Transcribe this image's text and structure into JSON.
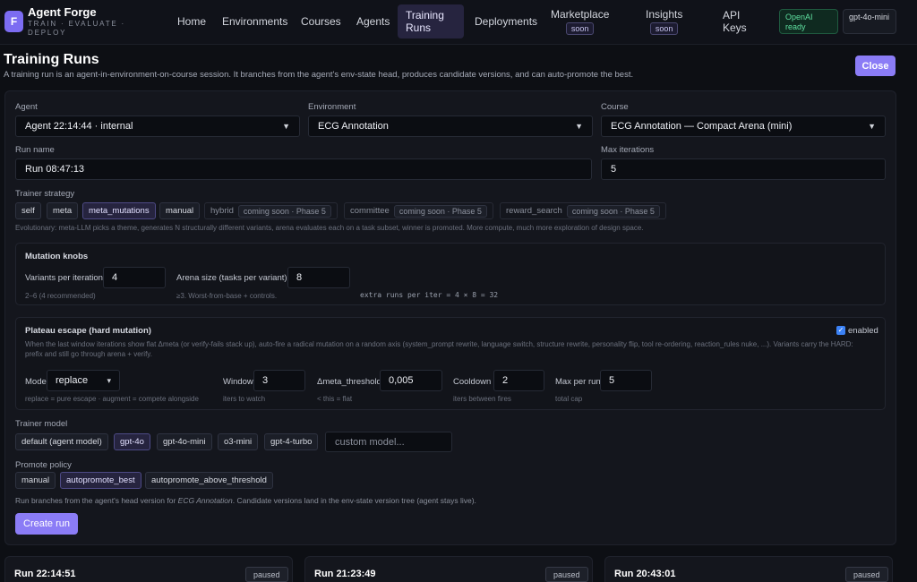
{
  "brand": {
    "logo_letter": "F",
    "title": "Agent Forge",
    "subtitle": "TRAIN · EVALUATE · DEPLOY"
  },
  "nav": [
    {
      "label": "Home"
    },
    {
      "label": "Environments"
    },
    {
      "label": "Courses"
    },
    {
      "label": "Agents"
    },
    {
      "label": "Training Runs",
      "active": true
    },
    {
      "label": "Deployments"
    },
    {
      "label": "Marketplace",
      "badge": "soon"
    },
    {
      "label": "Insights",
      "badge": "soon"
    },
    {
      "label": "API Keys"
    }
  ],
  "status": {
    "provider": "OpenAI ready",
    "model": "gpt-4o-mini"
  },
  "page": {
    "title": "Training Runs",
    "description": "A training run is an agent-in-environment-on-course session. It branches from the agent's env-state head, produces candidate versions, and can auto-promote the best.",
    "close_label": "Close"
  },
  "form": {
    "agent_label": "Agent",
    "agent_value": "Agent 22:14:44 · internal",
    "environment_label": "Environment",
    "environment_value": "ECG Annotation",
    "course_label": "Course",
    "course_value": "ECG Annotation — Compact Arena (mini)",
    "run_name_label": "Run name",
    "run_name_value": "Run 08:47:13",
    "max_iter_label": "Max iterations",
    "max_iter_value": "5",
    "strategy_label": "Trainer strategy",
    "strategies": [
      {
        "label": "self"
      },
      {
        "label": "meta"
      },
      {
        "label": "meta_mutations",
        "selected": true
      },
      {
        "label": "manual"
      },
      {
        "label": "hybrid",
        "tag": "coming soon · Phase 5"
      },
      {
        "label": "committee",
        "tag": "coming soon · Phase 5"
      },
      {
        "label": "reward_search",
        "tag": "coming soon · Phase 5"
      }
    ],
    "strategy_hint": "Evolutionary: meta-LLM picks a theme, generates N structurally different variants, arena evaluates each on a task subset, winner is promoted. More compute, much more exploration of design space.",
    "knobs": {
      "title": "Mutation knobs",
      "variants_label": "Variants per iteration",
      "variants_value": "4",
      "variants_hint": "2–6 (4 recommended)",
      "arena_label": "Arena size (tasks per variant)",
      "arena_value": "8",
      "arena_hint": "≥3. Worst-from-base + controls.",
      "extra_runs": "extra runs per iter = 4 × 8 = 32"
    },
    "plateau": {
      "title": "Plateau escape (hard mutation)",
      "enabled_label": "enabled",
      "desc": "When the last window iterations show flat Δmeta (or verify-fails stack up), auto-fire a radical mutation on a random axis (system_prompt rewrite, language switch, structure rewrite, personality flip, tool re-ordering, reaction_rules nuke, ...). Variants carry the HARD: prefix and still go through arena + verify.",
      "mode_label": "Mode",
      "mode_value": "replace",
      "mode_hint": "replace = pure escape · augment = compete alongside",
      "window_label": "Window",
      "window_value": "3",
      "window_hint": "iters to watch",
      "threshold_label": "Δmeta_threshold",
      "threshold_value": "0,005",
      "threshold_hint": "< this = flat",
      "cooldown_label": "Cooldown",
      "cooldown_value": "2",
      "cooldown_hint": "iters between fires",
      "maxrun_label": "Max per run",
      "maxrun_value": "5",
      "maxrun_hint": "total cap"
    },
    "trainer_model_label": "Trainer model",
    "trainer_models": [
      {
        "label": "default (agent model)"
      },
      {
        "label": "gpt-4o",
        "selected": true
      },
      {
        "label": "gpt-4o-mini"
      },
      {
        "label": "o3-mini"
      },
      {
        "label": "gpt-4-turbo"
      }
    ],
    "custom_model_placeholder": "custom model...",
    "promote_label": "Promote policy",
    "promote_options": [
      {
        "label": "manual"
      },
      {
        "label": "autopromote_best",
        "selected": true
      },
      {
        "label": "autopromote_above_threshold"
      }
    ],
    "branch_note_pre": "Run branches from the agent's head version for ",
    "branch_note_env": "ECG Annotation",
    "branch_note_post": ". Candidate versions land in the env-state version tree (agent stays live).",
    "create_label": "Create run"
  },
  "runs": [
    {
      "title": "Run 22:14:51",
      "status": "paused"
    },
    {
      "title": "Run 21:23:49",
      "status": "paused"
    },
    {
      "title": "Run 20:43:01",
      "status": "paused"
    }
  ]
}
